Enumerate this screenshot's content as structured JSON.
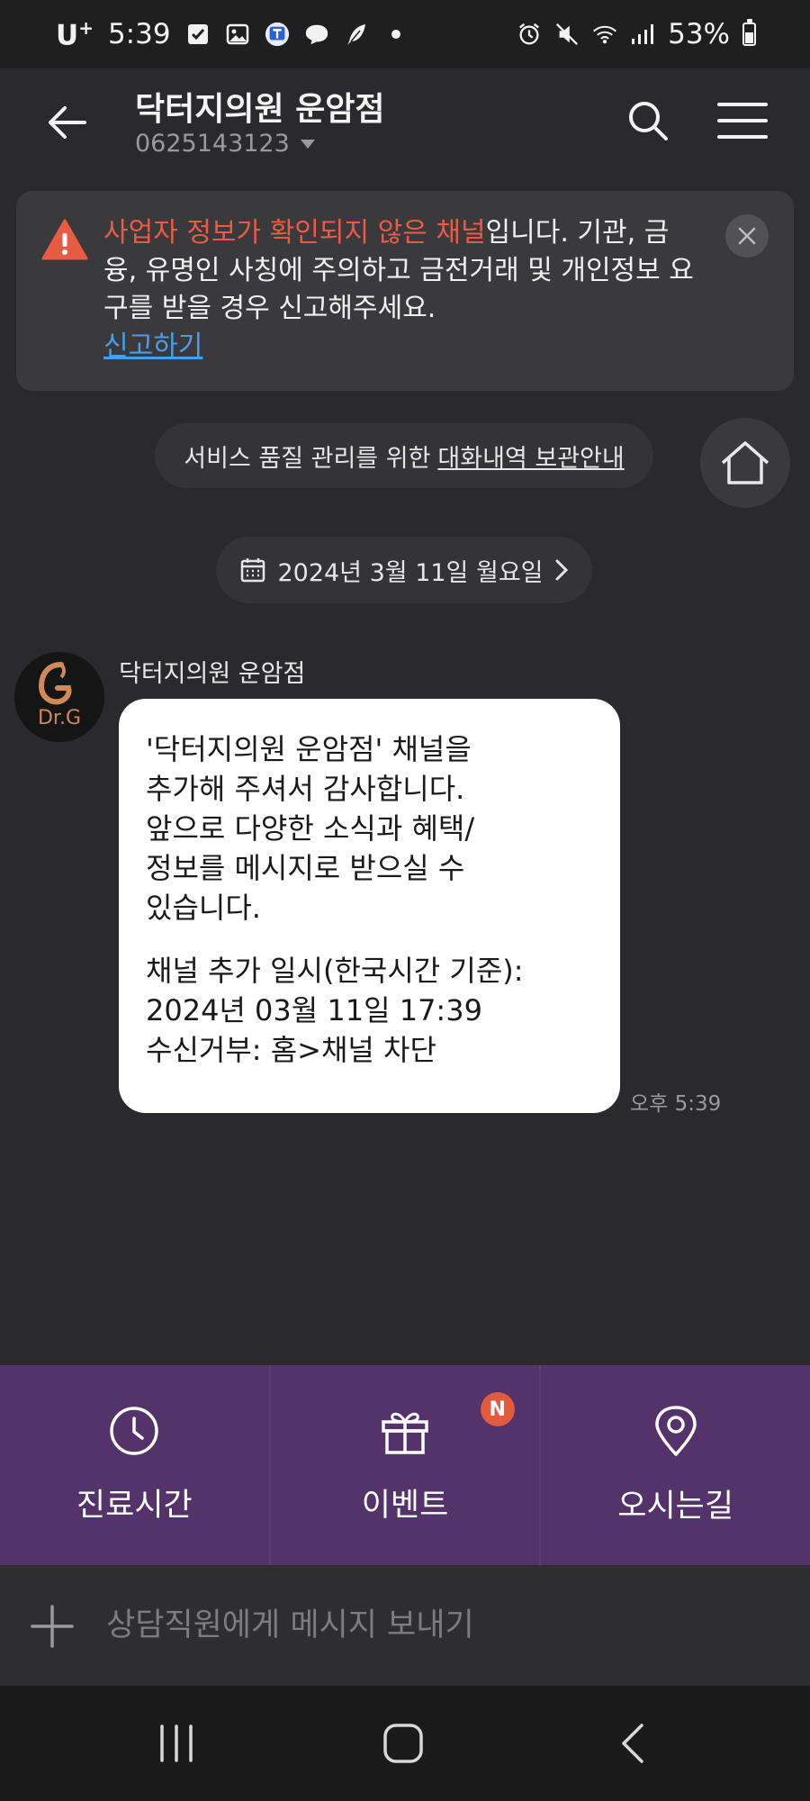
{
  "status_bar": {
    "carrier": "U",
    "carrier_sup": "+",
    "time": "5:39",
    "battery": "53%",
    "battery_level": 0.53
  },
  "header": {
    "title": "닥터지의원 운암점",
    "phone": "0625143123"
  },
  "notice": {
    "highlight": "사업자 정보가 확인되지 않은 채널",
    "text": "입니다. 기관, 금융, 유명인 사칭에 주의하고 금전거래 및 개인정보 요구를 받을 경우 신고해주세요.",
    "link": "신고하기",
    "highlight_color": "#ec5a46",
    "link_color": "#4a9ee8"
  },
  "info_chip": {
    "text": "서비스 품질 관리를 위한",
    "link": "대화내역 보관안내"
  },
  "date_chip": {
    "label": "2024년 3월 11일 월요일"
  },
  "chat": {
    "sender": "닥터지의원 운암점",
    "avatar_text": "Dr.G",
    "message_lines_1": [
      "'닥터지의원 운암점' 채널을",
      "추가해 주셔서 감사합니다.",
      "앞으로 다양한 소식과 혜택/",
      "정보를 메시지로 받으실 수",
      "있습니다."
    ],
    "message_lines_2": [
      "채널 추가 일시(한국시간 기준):",
      "2024년 03월 11일 17:39",
      "수신거부: 홈>채널 차단"
    ],
    "time": "오후 5:39"
  },
  "bottom_menu": {
    "items": [
      {
        "label": "진료시간",
        "icon": "clock-icon"
      },
      {
        "label": "이벤트",
        "icon": "gift-icon",
        "badge": "N"
      },
      {
        "label": "오시는길",
        "icon": "location-pin-icon"
      }
    ],
    "background": "#533369",
    "badge_color": "#e05b40"
  },
  "input": {
    "placeholder": "상담직원에게 메시지 보내기"
  }
}
